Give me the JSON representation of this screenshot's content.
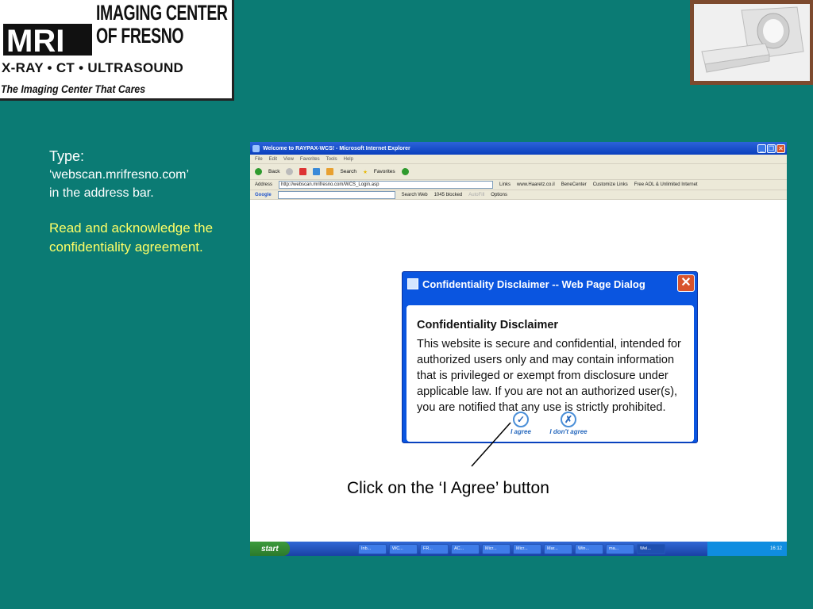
{
  "logo": {
    "mri": "MRI",
    "line1": "IMAGING CENTER",
    "line2": "OF FRESNO",
    "modalities": "X-RAY • CT • ULTRASOUND",
    "tagline": "The Imaging Center That Cares"
  },
  "instructions": {
    "type_label": "Type:",
    "url_text": "‘webscan.mrifresno.com’",
    "address_text": "in the address bar.",
    "acknowledge": "Read and acknowledge the confidentiality agreement."
  },
  "browser": {
    "title": "Welcome to RAYPAX-WCS! - Microsoft Internet Explorer",
    "menu": [
      "File",
      "Edit",
      "View",
      "Favorites",
      "Tools",
      "Help"
    ],
    "toolbar": {
      "back": "Back",
      "search": "Search",
      "favorites": "Favorites"
    },
    "address_label": "Address",
    "address_value": "http://webscan.mrifresno.com/WCS_Login.asp",
    "links": [
      "Links",
      "www.Haaretz.co.il",
      "BeneCenter",
      "Customize Links",
      "Free AOL & Unlimited Internet"
    ],
    "google": {
      "brand": "Google",
      "search_web": "Search Web",
      "blocked": "1045 blocked",
      "autofill": "AutoFill",
      "options": "Options"
    }
  },
  "taskbar": {
    "start": "start",
    "items": [
      "Inb...",
      "WC...",
      "FR...",
      "AC...",
      "Micr...",
      "Micr...",
      "Mar...",
      "Win...",
      "ma...",
      "Wel..."
    ],
    "clock": "16:12"
  },
  "dialog": {
    "title": "Confidentiality Disclaimer -- Web Page Dialog",
    "heading": "Confidentiality Disclaimer",
    "body": "This website is secure and confidential, intended for authorized users only and may contain information that is privileged or exempt from disclosure under applicable law. If you are not an authorized user(s), you are notified that any use is strictly prohibited.",
    "agree": "I agree",
    "disagree": "I don't agree"
  },
  "caption": "Click on the ‘I Agree’ button"
}
